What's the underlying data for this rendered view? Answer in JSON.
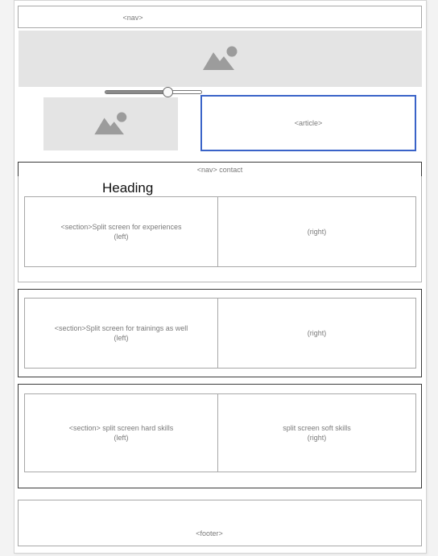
{
  "wireframe": {
    "top_nav": {
      "label": "<nav>"
    },
    "slider": {
      "value_fraction": 0.65
    },
    "article": {
      "label": "<article>",
      "accent_color": "#3a63c8"
    },
    "contact_nav": {
      "label": "<nav> contact"
    },
    "heading": "Heading",
    "sections": [
      {
        "left_line1": "<section>Split screen for experiences",
        "left_line2": "(left)",
        "right_line1": "(right)",
        "right_line2": ""
      },
      {
        "left_line1": "<section>Split screen for trainings as well",
        "left_line2": "(left)",
        "right_line1": "(right)",
        "right_line2": ""
      },
      {
        "left_line1": "<section> split screen hard skills",
        "left_line2": "(left)",
        "right_line1": "split screen soft skills",
        "right_line2": "(right)"
      }
    ],
    "footer": {
      "label": "<footer>"
    },
    "image_icon": "mountain-sun-image-icon"
  }
}
